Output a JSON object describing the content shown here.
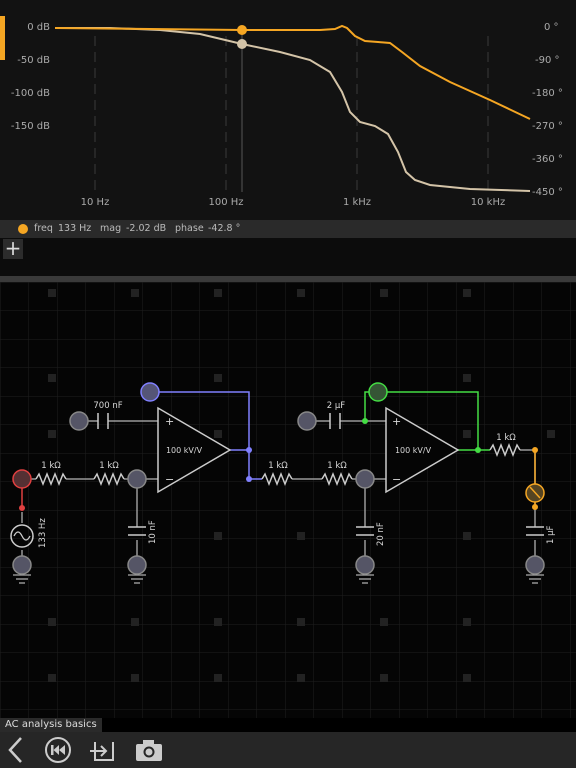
{
  "plot": {
    "left_axis": [
      "0 dB",
      "-50 dB",
      "-100 dB",
      "-150 dB"
    ],
    "right_axis": [
      "0 °",
      "-90 °",
      "-180 °",
      "-270 °",
      "-360 °",
      "-450 °"
    ],
    "x_axis": [
      "10 Hz",
      "100 Hz",
      "1 kHz",
      "10 kHz"
    ],
    "colors": {
      "magnitude": "#f5a623",
      "phase": "#d4c4a8"
    }
  },
  "readout": {
    "freq_label": "freq",
    "freq_value": "133 Hz",
    "mag_label": "mag",
    "mag_value": "-2.02 dB",
    "phase_label": "phase",
    "phase_value": "-42.8 °"
  },
  "add_button": "+",
  "circuit": {
    "r1": "1 kΩ",
    "r2": "1 kΩ",
    "c1": "700 nF",
    "c2": "10 nF",
    "opamp1_gain": "100 kV/V",
    "r3": "1 kΩ",
    "r4": "1 kΩ",
    "c3": "2 µF",
    "c4": "20 nF",
    "opamp2_gain": "100 kV/V",
    "r5": "1 kΩ",
    "c5": "1 µF",
    "source": "133 Hz",
    "plus_sign": "+",
    "minus_sign": "−",
    "colors": {
      "feedback1": "#8080ff",
      "feedback2": "#44dd44",
      "source_node": "#e04040",
      "output_node": "#f5a623"
    }
  },
  "circuit_name": "AC analysis basics",
  "toolbar": {
    "icons": [
      "chevron-left-icon",
      "rewind-icon",
      "export-icon",
      "camera-icon"
    ]
  }
}
